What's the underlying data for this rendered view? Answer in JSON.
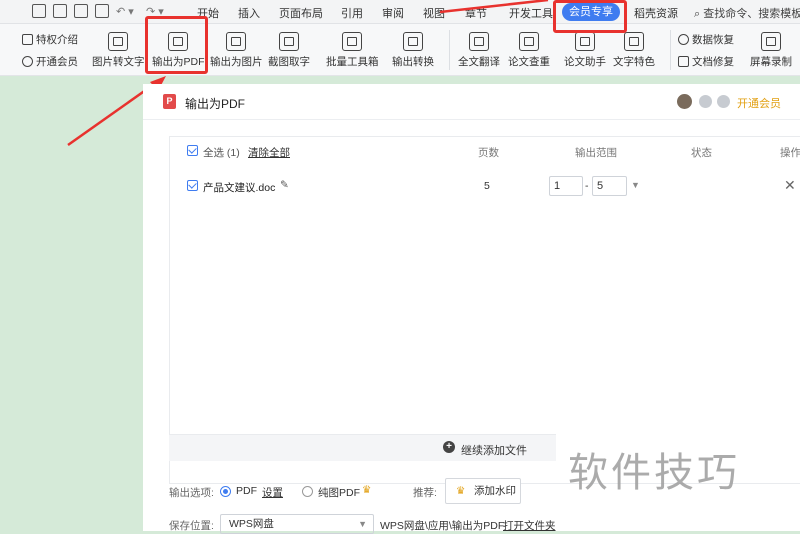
{
  "menubar": {
    "tabs": [
      "开始",
      "插入",
      "页面布局",
      "引用",
      "审阅",
      "视图",
      "章节",
      "开发工具"
    ],
    "vip_tab": "会员专享",
    "after_vip": "稻壳资源",
    "search": "查找命令、搜索模板"
  },
  "ribbon": {
    "left_small": [
      "特权介绍",
      "开通会员"
    ],
    "buttons": [
      "图片转文字",
      "输出为PDF",
      "输出为图片",
      "截图取字",
      "批量工具箱",
      "输出转换",
      "全文翻译",
      "论文查重",
      "论文助手",
      "文字特色"
    ],
    "right_small": [
      "数据恢复",
      "文档修复"
    ],
    "screen_record": "屏幕录制"
  },
  "dialog": {
    "title": "输出为PDF",
    "vip_link": "开通会员",
    "select_all": "全选 (1)",
    "clear_all": "清除全部",
    "col_pages": "页数",
    "col_range": "输出范围",
    "col_status": "状态",
    "col_action": "操作",
    "file": {
      "name": "产品文建议.doc",
      "pages": "5",
      "range_from": "1",
      "range_sep": "-",
      "range_to": "5"
    },
    "add_file": "继续添加文件",
    "output_option_label": "输出选项:",
    "opt_pdf": "PDF",
    "opt_settings": "设置",
    "opt_image_pdf": "纯图PDF",
    "recommend_label": "推荐:",
    "add_watermark": "添加水印",
    "save_label": "保存位置:",
    "save_value": "WPS网盘",
    "save_path": "WPS网盘\\应用\\输出为PDF",
    "open_folder": "打开文件夹"
  },
  "watermark_text": "软件技巧",
  "colors": {
    "accent": "#3f7cf0",
    "highlight": "#e8322e",
    "vip_gold": "#e2a013"
  }
}
